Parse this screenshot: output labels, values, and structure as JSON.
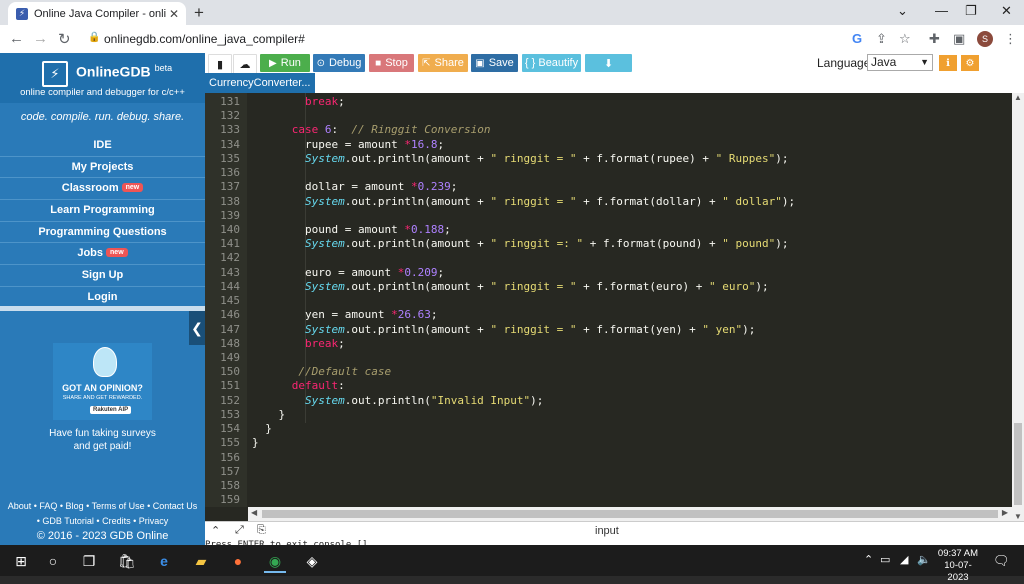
{
  "browser": {
    "tab_title": "Online Java Compiler - online ed",
    "url": "onlinegdb.com/online_java_compiler#",
    "avatar_letter": "S"
  },
  "sidebar": {
    "brand": "OnlineGDB",
    "brand_sup": "beta",
    "subtitle": "online compiler and debugger for c/c++",
    "tagline": "code. compile. run. debug. share.",
    "menu": [
      {
        "label": "IDE",
        "badge": ""
      },
      {
        "label": "My Projects",
        "badge": ""
      },
      {
        "label": "Classroom",
        "badge": "new"
      },
      {
        "label": "Learn Programming",
        "badge": ""
      },
      {
        "label": "Programming Questions",
        "badge": ""
      },
      {
        "label": "Jobs",
        "badge": "new"
      },
      {
        "label": "Sign Up",
        "badge": ""
      },
      {
        "label": "Login",
        "badge": ""
      }
    ],
    "ad": {
      "headline": "GOT AN OPINION?",
      "subline": "SHARE AND GET REWARDED.",
      "brand": "Rakuten AIP",
      "text_line1": "Have fun taking surveys",
      "text_line2": "and get paid!"
    },
    "footer": {
      "line1": "About • FAQ • Blog • Terms of Use • Contact Us",
      "line2": "• GDB Tutorial • Credits • Privacy",
      "line3": "© 2016 - 2023 GDB Online"
    }
  },
  "toolbar": {
    "run": "Run",
    "debug": "Debug",
    "stop": "Stop",
    "share": "Share",
    "save": "Save",
    "beautify": "{ } Beautify",
    "language_label": "Language",
    "language_value": "Java"
  },
  "file_tab": {
    "name": "CurrencyConverter..."
  },
  "editor": {
    "lines": [
      {
        "n": "131",
        "i": 8,
        "t": [
          [
            "kw",
            "break"
          ],
          [
            "",
            "; "
          ]
        ]
      },
      {
        "n": "132",
        "i": 0,
        "t": []
      },
      {
        "n": "133",
        "i": 6,
        "t": [
          [
            "kw",
            "case "
          ],
          [
            "num",
            "6"
          ],
          [
            "",
            ":  "
          ],
          [
            "cmt",
            "// Ringgit Conversion"
          ]
        ]
      },
      {
        "n": "134",
        "i": 8,
        "t": [
          [
            "",
            "rupee = amount "
          ],
          [
            "kw",
            "*"
          ],
          [
            "num",
            "16.8"
          ],
          [
            "",
            ";"
          ]
        ]
      },
      {
        "n": "135",
        "i": 8,
        "t": [
          [
            "cls",
            "System"
          ],
          [
            "",
            ".out.println(amount + "
          ],
          [
            "str",
            "\" ringgit = \""
          ],
          [
            "",
            " + f.format(rupee) + "
          ],
          [
            "str",
            "\" Ruppes\""
          ],
          [
            "",
            ");"
          ]
        ]
      },
      {
        "n": "136",
        "i": 0,
        "t": []
      },
      {
        "n": "137",
        "i": 8,
        "t": [
          [
            "",
            "dollar = amount "
          ],
          [
            "kw",
            "*"
          ],
          [
            "num",
            "0.239"
          ],
          [
            "",
            ";"
          ]
        ]
      },
      {
        "n": "138",
        "i": 8,
        "t": [
          [
            "cls",
            "System"
          ],
          [
            "",
            ".out.println(amount + "
          ],
          [
            "str",
            "\" ringgit = \""
          ],
          [
            "",
            " + f.format(dollar) + "
          ],
          [
            "str",
            "\" dollar\""
          ],
          [
            "",
            ");"
          ]
        ]
      },
      {
        "n": "139",
        "i": 0,
        "t": []
      },
      {
        "n": "140",
        "i": 8,
        "t": [
          [
            "",
            "pound = amount "
          ],
          [
            "kw",
            "*"
          ],
          [
            "num",
            "0.188"
          ],
          [
            "",
            ";"
          ]
        ]
      },
      {
        "n": "141",
        "i": 8,
        "t": [
          [
            "cls",
            "System"
          ],
          [
            "",
            ".out.println(amount + "
          ],
          [
            "str",
            "\" ringgit =: \""
          ],
          [
            "",
            " + f.format(pound) + "
          ],
          [
            "str",
            "\" pound\""
          ],
          [
            "",
            ");"
          ]
        ]
      },
      {
        "n": "142",
        "i": 0,
        "t": []
      },
      {
        "n": "143",
        "i": 8,
        "t": [
          [
            "",
            "euro = amount "
          ],
          [
            "kw",
            "*"
          ],
          [
            "num",
            "0.209"
          ],
          [
            "",
            ";"
          ]
        ]
      },
      {
        "n": "144",
        "i": 8,
        "t": [
          [
            "cls",
            "System"
          ],
          [
            "",
            ".out.println(amount + "
          ],
          [
            "str",
            "\" ringgit = \""
          ],
          [
            "",
            " + f.format(euro) + "
          ],
          [
            "str",
            "\" euro\""
          ],
          [
            "",
            ");"
          ]
        ]
      },
      {
        "n": "145",
        "i": 0,
        "t": []
      },
      {
        "n": "146",
        "i": 8,
        "t": [
          [
            "",
            "yen = amount "
          ],
          [
            "kw",
            "*"
          ],
          [
            "num",
            "26.63"
          ],
          [
            "",
            ";"
          ]
        ]
      },
      {
        "n": "147",
        "i": 8,
        "t": [
          [
            "cls",
            "System"
          ],
          [
            "",
            ".out.println(amount + "
          ],
          [
            "str",
            "\" ringgit = \""
          ],
          [
            "",
            " + f.format(yen) + "
          ],
          [
            "str",
            "\" yen\""
          ],
          [
            "",
            ");"
          ]
        ]
      },
      {
        "n": "148",
        "i": 8,
        "t": [
          [
            "kw",
            "break"
          ],
          [
            "",
            ";"
          ]
        ]
      },
      {
        "n": "149",
        "i": 0,
        "t": []
      },
      {
        "n": "150",
        "i": 7,
        "t": [
          [
            "cmt",
            "//Default case"
          ]
        ]
      },
      {
        "n": "151",
        "i": 6,
        "t": [
          [
            "kw",
            "default"
          ],
          [
            "",
            ":"
          ]
        ]
      },
      {
        "n": "152",
        "i": 8,
        "t": [
          [
            "cls",
            "System"
          ],
          [
            "",
            ".out.println("
          ],
          [
            "str",
            "\"Invalid Input\""
          ],
          [
            "",
            ");"
          ]
        ]
      },
      {
        "n": "153",
        "i": 4,
        "t": [
          [
            "",
            "}"
          ]
        ]
      },
      {
        "n": "154",
        "i": 2,
        "t": [
          [
            "",
            "}"
          ]
        ]
      },
      {
        "n": "155",
        "i": 0,
        "t": [
          [
            "",
            "}"
          ]
        ]
      },
      {
        "n": "156",
        "i": 0,
        "t": []
      },
      {
        "n": "157",
        "i": 0,
        "t": []
      },
      {
        "n": "158",
        "i": 0,
        "t": []
      },
      {
        "n": "159",
        "i": 0,
        "t": []
      }
    ]
  },
  "console": {
    "label": "input",
    "text": "Press ENTER to exit console.[]"
  },
  "taskbar": {
    "time": "09:37 AM",
    "date": "10-07-2023"
  }
}
